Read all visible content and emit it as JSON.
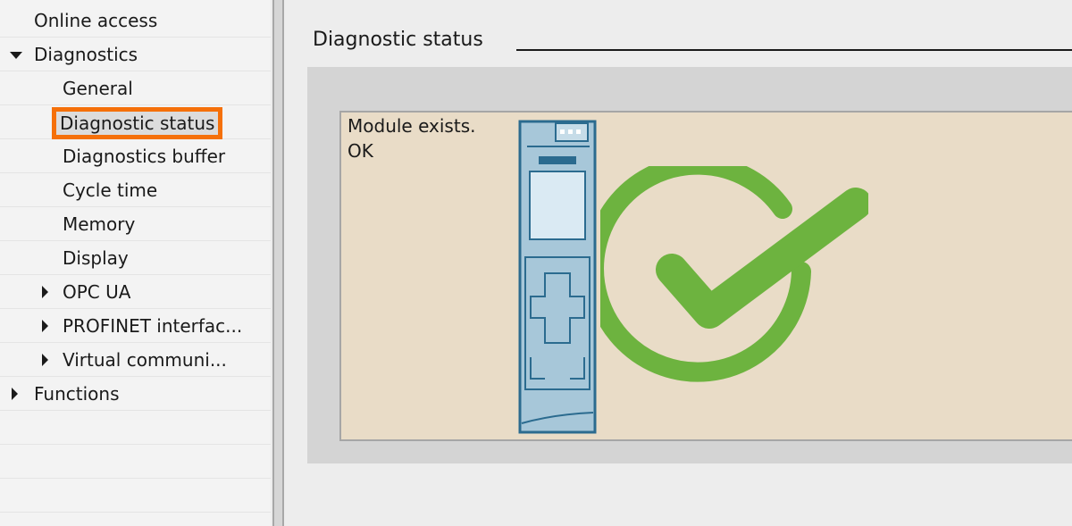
{
  "nav": {
    "items": [
      {
        "label": "Online access",
        "level": 0,
        "expander": "none",
        "selected": false
      },
      {
        "label": "Diagnostics",
        "level": 0,
        "expander": "expanded",
        "selected": false
      },
      {
        "label": "General",
        "level": 1,
        "expander": "none",
        "selected": false
      },
      {
        "label": "Diagnostic status",
        "level": 1,
        "expander": "none",
        "selected": true
      },
      {
        "label": "Diagnostics buffer",
        "level": 1,
        "expander": "none",
        "selected": false
      },
      {
        "label": "Cycle time",
        "level": 1,
        "expander": "none",
        "selected": false
      },
      {
        "label": "Memory",
        "level": 1,
        "expander": "none",
        "selected": false
      },
      {
        "label": "Display",
        "level": 1,
        "expander": "none",
        "selected": false
      },
      {
        "label": "OPC UA",
        "level": 1,
        "expander": "collapsed",
        "selected": false
      },
      {
        "label": "PROFINET interfac...",
        "level": 1,
        "expander": "collapsed",
        "selected": false
      },
      {
        "label": "Virtual communi...",
        "level": 1,
        "expander": "collapsed",
        "selected": false
      },
      {
        "label": "Functions",
        "level": 0,
        "expander": "collapsed",
        "selected": false
      }
    ]
  },
  "main": {
    "section_title": "Diagnostic status",
    "status_lines": [
      "Module exists.",
      "OK"
    ],
    "module_icon": "cpu-module-icon",
    "status_icon": "ok-checkmark-icon"
  },
  "colors": {
    "selection_highlight": "#f5700a",
    "status_box_bg": "#e9dcc7",
    "check_green": "#6db33f",
    "module_blue": "#a7c7d9",
    "module_outline": "#2b6b8f"
  }
}
